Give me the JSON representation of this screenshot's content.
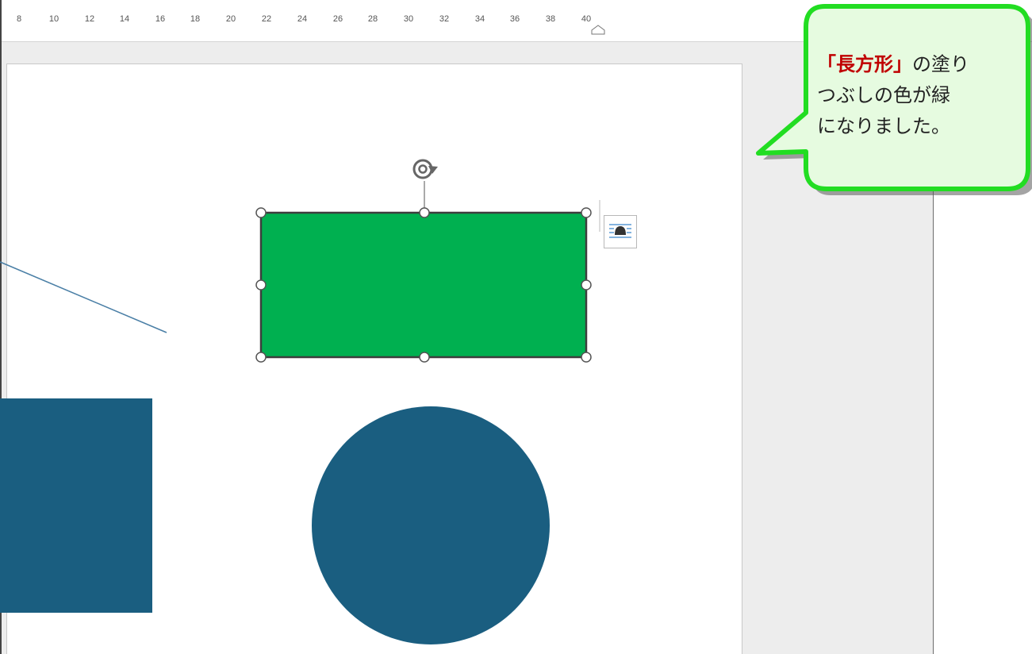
{
  "ruler": {
    "ticks": [
      "8",
      "10",
      "12",
      "14",
      "16",
      "18",
      "20",
      "22",
      "24",
      "26",
      "28",
      "30",
      "32",
      "34",
      "36",
      "38",
      "40"
    ]
  },
  "callout": {
    "highlight": "「長方形」",
    "rest_line1": "の塗り",
    "line2": "つぶしの色が緑",
    "line3": "になりました。"
  },
  "shapes": {
    "rectangle_fill": "#00b050",
    "blue_fill": "#1a5e80",
    "callout_fill": "#e6fbe0",
    "callout_border": "#22dd22"
  },
  "icons": {
    "rotate": "rotate-handle-icon",
    "layout": "layout-options-icon"
  }
}
